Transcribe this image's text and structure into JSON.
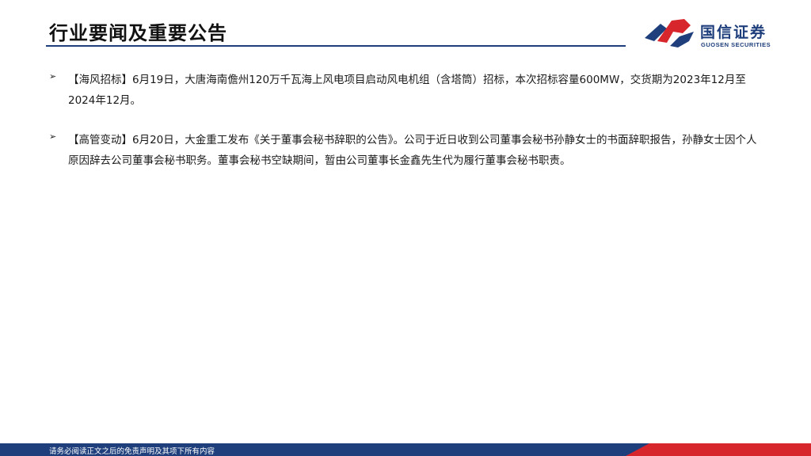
{
  "header": {
    "title": "行业要闻及重要公告"
  },
  "logo": {
    "name_cn": "国信证券",
    "name_en": "GUOSEN SECURITIES",
    "icon": "guosen-logo-icon"
  },
  "bullets": [
    {
      "marker": "➢",
      "text": "【海风招标】6月19日，大唐海南儋州120万千瓦海上风电项目启动风电机组（含塔筒）招标，本次招标容量600MW，交货期为2023年12月至2024年12月。"
    },
    {
      "marker": "➢",
      "text": "【高管变动】6月20日，大金重工发布《关于董事会秘书辞职的公告》。公司于近日收到公司董事会秘书孙静女士的书面辞职报告，孙静女士因个人原因辞去公司董事会秘书职务。董事会秘书空缺期间，暂由公司董事长金鑫先生代为履行董事会秘书职责。"
    }
  ],
  "footer": {
    "text": "请务必阅读正文之后的免责声明及其项下所有内容"
  },
  "colors": {
    "brand_blue": "#1e3f7c",
    "brand_red": "#d7262c"
  }
}
